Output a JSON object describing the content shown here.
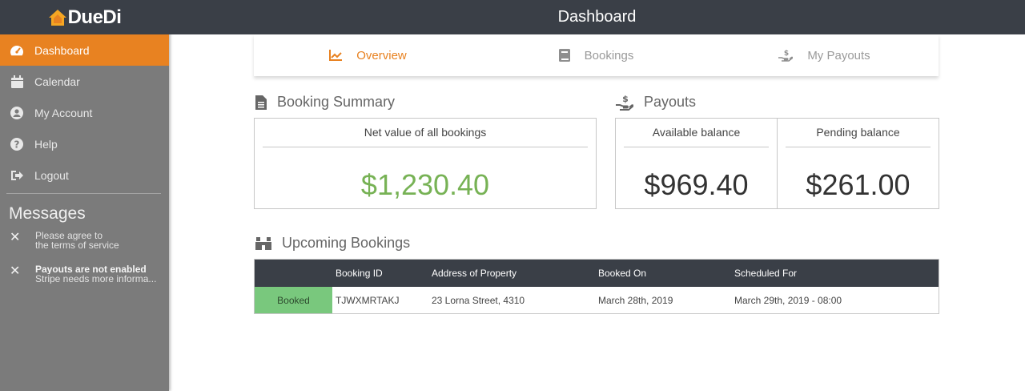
{
  "app": {
    "logo_text": "DueDi",
    "page_title": "Dashboard"
  },
  "sidebar": {
    "items": [
      {
        "label": "Dashboard",
        "icon": "gauge-icon",
        "active": true
      },
      {
        "label": "Calendar",
        "icon": "calendar-icon",
        "active": false
      },
      {
        "label": "My Account",
        "icon": "user-circle-icon",
        "active": false
      },
      {
        "label": "Help",
        "icon": "question-circle-icon",
        "active": false
      },
      {
        "label": "Logout",
        "icon": "logout-icon",
        "active": false
      }
    ],
    "messages_title": "Messages",
    "messages": [
      {
        "line1": "Please agree to",
        "line2": "the terms of service",
        "bold": false
      },
      {
        "line1": "Payouts are not enabled",
        "line2": "Stripe needs more informa...",
        "bold": true
      }
    ]
  },
  "tabs": [
    {
      "label": "Overview",
      "icon": "line-chart-icon",
      "active": true
    },
    {
      "label": "Bookings",
      "icon": "book-icon",
      "active": false
    },
    {
      "label": "My Payouts",
      "icon": "hand-money-icon",
      "active": false
    }
  ],
  "booking_summary": {
    "title": "Booking Summary",
    "net_label": "Net value of all bookings",
    "net_value": "$1,230.40"
  },
  "payouts": {
    "title": "Payouts",
    "available_label": "Available balance",
    "available_value": "$969.40",
    "pending_label": "Pending balance",
    "pending_value": "$261.00"
  },
  "upcoming": {
    "title": "Upcoming Bookings",
    "columns": [
      "",
      "Booking ID",
      "Address of Property",
      "Booked On",
      "Scheduled For"
    ],
    "rows": [
      {
        "status": "Booked",
        "booking_id": "TJWXMRTAKJ",
        "address": "23 Lorna Street, 4310",
        "booked_on": "March 28th, 2019",
        "scheduled_for": "March 29th, 2019 - 08:00"
      }
    ]
  },
  "colors": {
    "accent": "#e88221",
    "topbar": "#3a3f47",
    "sidebar": "#7b7b7b",
    "positive": "#77b255",
    "status_booked": "#79c87d"
  }
}
